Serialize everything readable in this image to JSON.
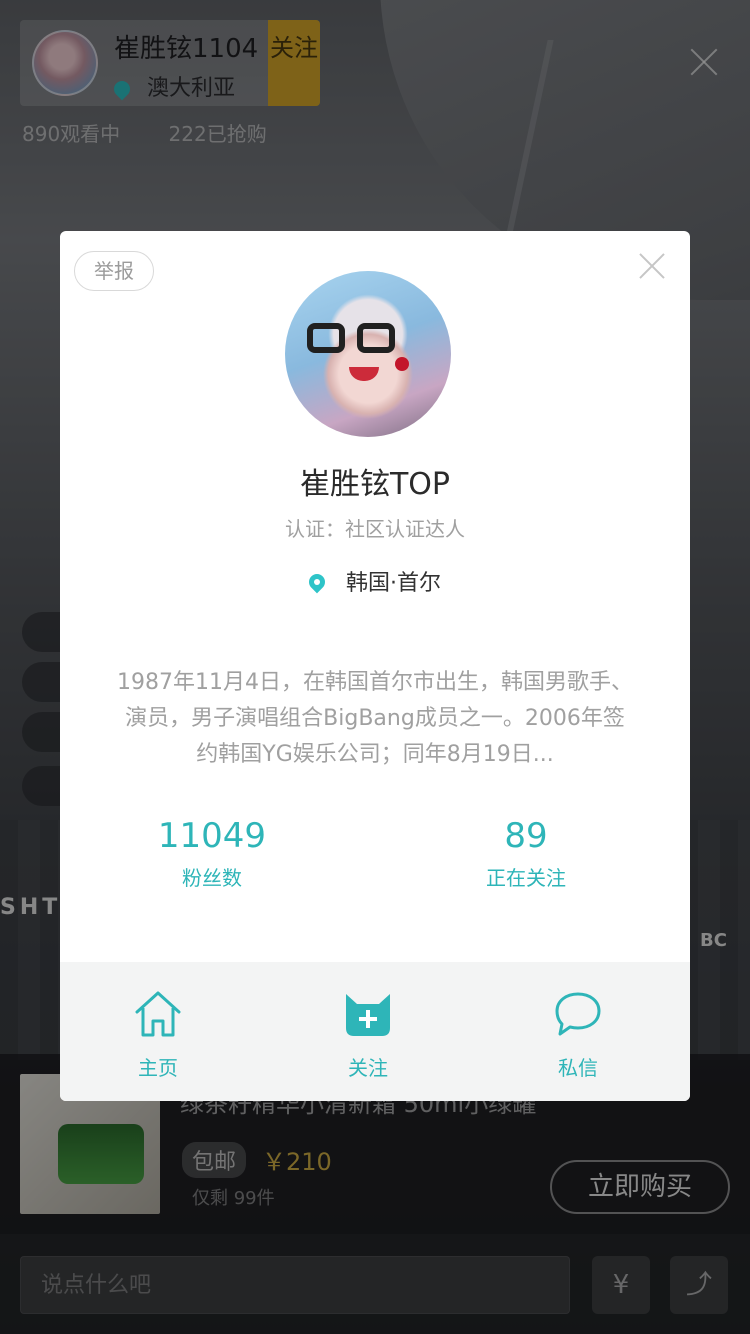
{
  "host": {
    "name": "崔胜铉1104",
    "location": "澳大利亚",
    "follow_label": "关注"
  },
  "live_stats": {
    "viewers": "890观看中",
    "purchased": "222已抢购"
  },
  "product": {
    "title": "绿茶籽精华小清新霜 50ml小绿罐",
    "shipping_badge": "包邮",
    "price": "￥210",
    "stock": "仅剩 99件",
    "buy_label": "立即购买"
  },
  "comment_input": {
    "placeholder": "说点什么吧"
  },
  "profile": {
    "report_label": "举报",
    "name": "崔胜铉TOP",
    "certification": "认证：社区认证达人",
    "location": "韩国·首尔",
    "bio": "1987年11月4日，在韩国首尔市出生，韩国男歌手、演员，男子演唱组合BigBang成员之一。2006年签约韩国YG娱乐公司；同年8月19日...",
    "followers_count": "11049",
    "followers_label": "粉丝数",
    "following_count": "89",
    "following_label": "正在关注"
  },
  "profile_actions": [
    {
      "label": "主页",
      "icon": "home-icon"
    },
    {
      "label": "关注",
      "icon": "add-follow-icon"
    },
    {
      "label": "私信",
      "icon": "chat-bubble-icon"
    }
  ],
  "colors": {
    "accent": "#2eb5b8",
    "follow_badge": "#d9a92a",
    "price": "#d4b146"
  }
}
